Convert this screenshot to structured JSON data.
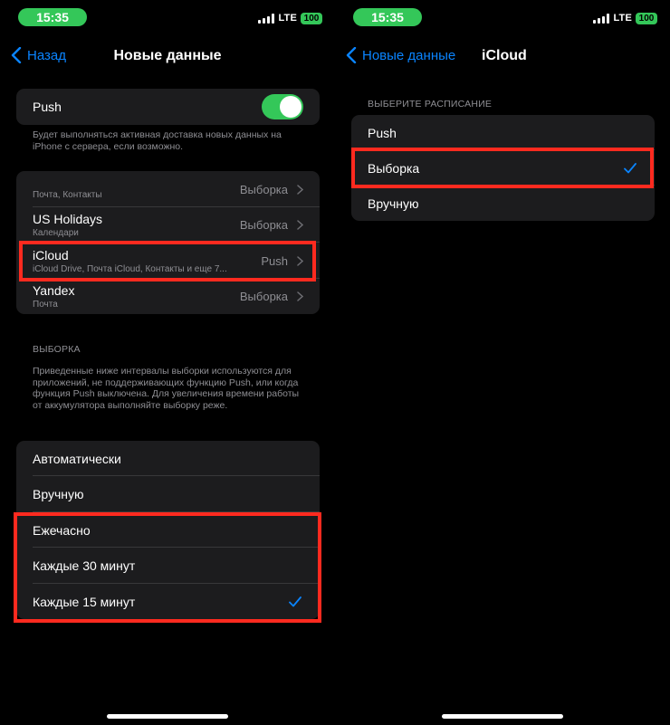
{
  "status": {
    "time": "15:35",
    "network": "LTE",
    "battery": "100"
  },
  "left": {
    "nav": {
      "back_label": "Назад",
      "title": "Новые данные"
    },
    "push": {
      "label": "Push",
      "footnote": "Будет выполняться активная доставка новых данных на iPhone с сервера, если возможно."
    },
    "accounts": [
      {
        "name": "",
        "subtitle": "Почта, Контакты",
        "value": "Выборка"
      },
      {
        "name": "US Holidays",
        "subtitle": "Календари",
        "value": "Выборка"
      },
      {
        "name": "iCloud",
        "subtitle": "iCloud Drive, Почта iCloud, Контакты и еще 7...",
        "value": "Push"
      },
      {
        "name": "Yandex",
        "subtitle": "Почта",
        "value": "Выборка"
      }
    ],
    "fetch_section": {
      "header": "ВЫБОРКА",
      "footnote": "Приведенные ниже интервалы выборки используются для приложений, не поддерживающих функцию Push, или когда функция Push выключена. Для увеличения времени работы от аккумулятора выполняйте выборку реже."
    },
    "intervals": [
      {
        "label": "Автоматически",
        "selected": false
      },
      {
        "label": "Вручную",
        "selected": false
      },
      {
        "label": "Ежечасно",
        "selected": false
      },
      {
        "label": "Каждые 30 минут",
        "selected": false
      },
      {
        "label": "Каждые 15 минут",
        "selected": true
      }
    ]
  },
  "right": {
    "nav": {
      "back_label": "Новые данные",
      "title": "iCloud"
    },
    "schedule": {
      "header": "ВЫБЕРИТЕ РАСПИСАНИЕ",
      "options": [
        {
          "label": "Push",
          "selected": false
        },
        {
          "label": "Выборка",
          "selected": true
        },
        {
          "label": "Вручную",
          "selected": false
        }
      ]
    }
  },
  "colors": {
    "accent": "#0a84ff",
    "toggle_on": "#34c759",
    "highlight": "#ff2a1f",
    "cell": "#1c1c1e"
  }
}
